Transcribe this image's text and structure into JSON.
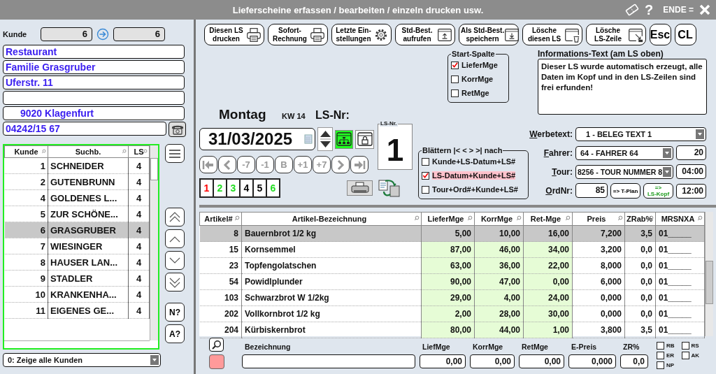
{
  "window": {
    "title": "Lieferscheine erfassen / bearbeiten / einzeln drucken usw.",
    "help": "?",
    "exit_label": "ENDE ="
  },
  "customer": {
    "label": "Kunde",
    "from": "6",
    "to": "6",
    "address": {
      "line_1": {
        "value": "Restaurant",
        "indented": false
      },
      "line_2": {
        "value": "Familie Grasgruber",
        "indented": false
      },
      "line_3": {
        "value": "Uferstr. 11",
        "indented": false
      },
      "line_5": {
        "value": "9020 Klagenfurt",
        "indented": true
      }
    },
    "phone": "04242/15 67"
  },
  "customer_table": {
    "columns": [
      {
        "label": "Kunde",
        "kind": "number"
      },
      {
        "label": "Suchb.",
        "kind": "text"
      },
      {
        "label": "LS",
        "kind": "center"
      }
    ],
    "rows": [
      {
        "cells": [
          "1",
          "SCHNEIDER",
          "4"
        ],
        "selected": false
      },
      {
        "cells": [
          "2",
          "GUTENBRUNN",
          "4"
        ],
        "selected": false
      },
      {
        "cells": [
          "4",
          "GOLDENES L...",
          "4"
        ],
        "selected": false
      },
      {
        "cells": [
          "5",
          "ZUR SCHÖNE...",
          "4"
        ],
        "selected": false
      },
      {
        "cells": [
          "6",
          "GRASGRUBER",
          "4"
        ],
        "selected": true
      },
      {
        "cells": [
          "7",
          "WIESINGER",
          "4"
        ],
        "selected": false
      },
      {
        "cells": [
          "8",
          "HAUSER LAN...",
          "4"
        ],
        "selected": false
      },
      {
        "cells": [
          "9",
          "STADLER",
          "4"
        ],
        "selected": false
      },
      {
        "cells": [
          "10",
          "KRANKENHA...",
          "4"
        ],
        "selected": false
      },
      {
        "cells": [
          "11",
          "EIGENES GE...",
          "4"
        ],
        "selected": false
      }
    ]
  },
  "customer_filter": "0: Zeige alle Kunden",
  "side_buttons": [
    "N?",
    "A?"
  ],
  "toolbar": [
    {
      "label": "Diesen LS\ndrucken",
      "kind": "printer"
    },
    {
      "label": "Sofort-\nRechnung",
      "kind": "printer"
    },
    {
      "label": "Letzte Ein-\nstellungen",
      "kind": "gear"
    },
    {
      "label": "Std-Best.\naufrufen",
      "kind": "upload"
    },
    {
      "label": "Als Std-Best.\nspeichern",
      "kind": "download"
    },
    {
      "label": "Lösche\ndiesen LS",
      "kind": "trash"
    },
    {
      "label": "Lösche\nLS-Zeile",
      "kind": "cursor"
    },
    {
      "label": "Esc",
      "kind": "plain"
    },
    {
      "label": "CL",
      "kind": "plain"
    }
  ],
  "start_column": {
    "title": "Start-Spalte",
    "options": [
      {
        "label": "LieferMge",
        "checked": true
      },
      {
        "label": "KorrMge",
        "checked": false
      },
      {
        "label": "RetMge",
        "checked": false
      }
    ]
  },
  "info": {
    "label": "Informations-Text (am LS oben)",
    "text": "Dieser LS wurde automatisch erzeugt, alle Daten im Kopf und in den LS-Zeilen sind frei erfunden!"
  },
  "date": {
    "weekday": "Montag",
    "week": "KW 14",
    "ls_label": "LS-Nr:",
    "value": "31/03/2025",
    "tree_on": true
  },
  "ls_box": {
    "title": "LS-Nr.",
    "value": "1"
  },
  "nav": [
    {
      "kind": "first",
      "disabled": true
    },
    {
      "kind": "prev",
      "disabled": true
    },
    {
      "kind": "text",
      "label": "-7",
      "disabled": true
    },
    {
      "kind": "text",
      "label": "-1",
      "disabled": true
    },
    {
      "kind": "text",
      "label": "B",
      "disabled": true
    },
    {
      "kind": "text",
      "label": "+1",
      "disabled": true
    },
    {
      "kind": "text",
      "label": "+7",
      "disabled": true
    },
    {
      "kind": "next",
      "disabled": true
    },
    {
      "kind": "last",
      "disabled": true
    }
  ],
  "copies": [
    {
      "label": "1",
      "color": "#ff0000"
    },
    {
      "label": "2",
      "color": "#22dd22"
    },
    {
      "label": "3",
      "color": "#22dd22"
    },
    {
      "label": "4",
      "color": "#000000"
    },
    {
      "label": "5",
      "color": "#000000"
    },
    {
      "label": "6",
      "color": "#22dd22"
    }
  ],
  "browse": {
    "title": "Blättern |< < > >| nach",
    "options": [
      {
        "label": "Kunde+LS-Datum+LS#",
        "selected": false
      },
      {
        "label": "LS-Datum+Kunde+LS#",
        "selected": true
      },
      {
        "label": "Tour+Ord#+Kunde+LS#",
        "selected": false
      }
    ]
  },
  "fields": {
    "werbetext": {
      "label": "Werbetext:",
      "value": "1 - BELEG TEXT 1"
    },
    "fahrer": {
      "label": "Fahrer:",
      "value": "64 - FAHRER 64",
      "extra": "20"
    },
    "tour": {
      "label": "Tour:",
      "value": "8256 - TOUR NUMMER 8",
      "extra": "04:00"
    },
    "ordnr": {
      "label": "OrdNr:",
      "value": "85",
      "tplan": "=> T-Plan",
      "lskopf": "=>\nLS-Kopf",
      "time": "12:00"
    }
  },
  "items_table": {
    "columns": [
      {
        "label": "Artikel#",
        "kind": "number",
        "highlight": false
      },
      {
        "label": "Artikel-Bezeichnung",
        "kind": "text",
        "highlight": false
      },
      {
        "label": "LieferMge",
        "kind": "number",
        "highlight": true
      },
      {
        "label": "KorrMge",
        "kind": "number",
        "highlight": true
      },
      {
        "label": "Ret-Mge",
        "kind": "number",
        "highlight": true
      },
      {
        "label": "Preis",
        "kind": "number",
        "highlight": false
      },
      {
        "label": "ZRab%",
        "kind": "number",
        "highlight": false
      },
      {
        "label": "MRSNXA",
        "kind": "text",
        "highlight": false
      }
    ],
    "rows": [
      {
        "cells": [
          "8",
          "Bauernbrot 1/2 kg",
          "5,00",
          "10,00",
          "16,00",
          "7,200",
          "3,5",
          "01_____"
        ],
        "selected": true
      },
      {
        "cells": [
          "15",
          "Kornsemmel",
          "87,00",
          "46,00",
          "34,00",
          "3,200",
          "0,0",
          "01_____"
        ],
        "selected": false
      },
      {
        "cells": [
          "23",
          "Topfengolatschen",
          "63,00",
          "36,00",
          "22,00",
          "8,000",
          "0,0",
          "01_____"
        ],
        "selected": false
      },
      {
        "cells": [
          "54",
          "Powidlplunder",
          "90,00",
          "47,00",
          "0,00",
          "6,000",
          "0,0",
          "01_____"
        ],
        "selected": false
      },
      {
        "cells": [
          "103",
          "Schwarzbrot W 1/2kg",
          "29,00",
          "4,00",
          "24,00",
          "0,000",
          "0,0",
          "01_____"
        ],
        "selected": false
      },
      {
        "cells": [
          "202",
          "Vollkornbrot 1/2 kg",
          "2,00",
          "28,00",
          "30,00",
          "0,000",
          "0,0",
          "01_____"
        ],
        "selected": false
      },
      {
        "cells": [
          "204",
          "Kürbiskernbrot",
          "80,00",
          "44,00",
          "1,00",
          "3,800",
          "3,5",
          "01_____"
        ],
        "selected": false
      }
    ]
  },
  "entry": [
    {
      "label": "Bezeichnung"
    },
    {
      "label": "LiefMge",
      "value": "0,00"
    },
    {
      "label": "KorrMge",
      "value": "0,00"
    },
    {
      "label": "RetMge",
      "value": "0,00"
    },
    {
      "label": "E-Preis",
      "value": "0,000"
    },
    {
      "label": "ZR%",
      "value": "0,0"
    }
  ],
  "flags": [
    {
      "label": "RB",
      "checked": false
    },
    {
      "label": "ER",
      "checked": false
    },
    {
      "label": "NP",
      "checked": false
    },
    {
      "label": "RS",
      "checked": false
    },
    {
      "label": "AK",
      "checked": false
    }
  ]
}
